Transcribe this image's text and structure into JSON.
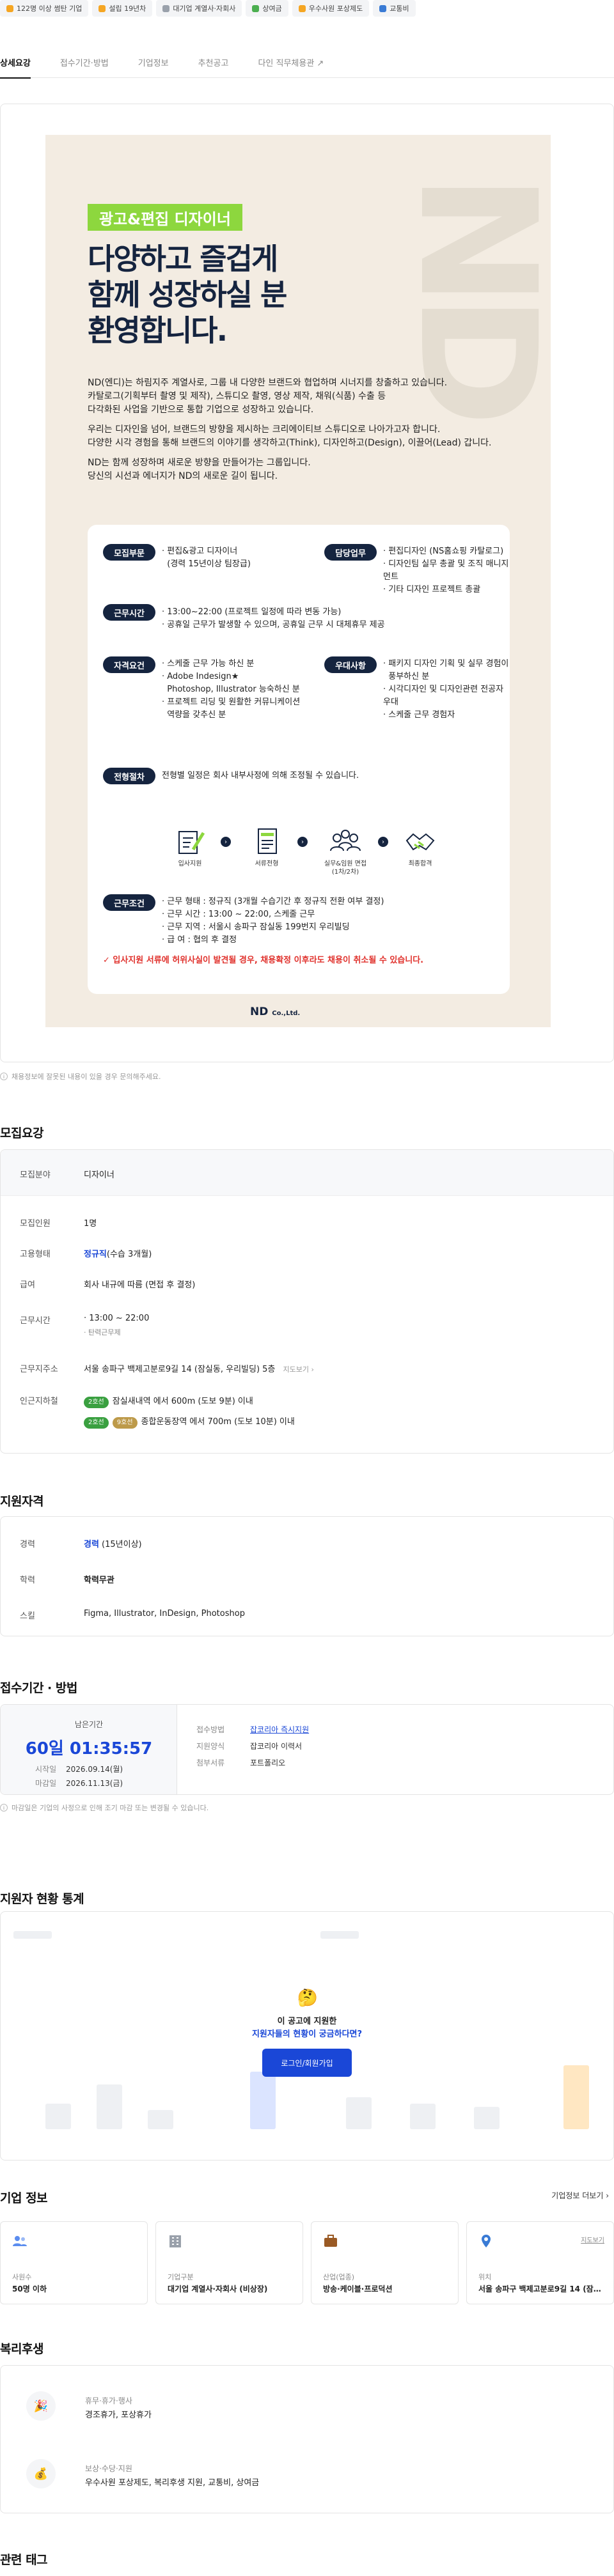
{
  "chips": [
    {
      "label": "122명 이상 썸탄 기업",
      "color": "#f5a623"
    },
    {
      "label": "설립 19년차",
      "color": "#f5a623"
    },
    {
      "label": "대기업 계열사·자회사",
      "color": "#9aa1ab"
    },
    {
      "label": "상여금",
      "color": "#4caf50"
    },
    {
      "label": "우수사원 포상제도",
      "color": "#f5a623"
    },
    {
      "label": "교통비",
      "color": "#3a7bd5"
    }
  ],
  "tabs": [
    {
      "label": "상세요강"
    },
    {
      "label": "접수기간·방법"
    },
    {
      "label": "기업정보"
    },
    {
      "label": "추천공고"
    },
    {
      "label": "다인 직무체용관 ↗"
    }
  ],
  "poster": {
    "watermark": "ND",
    "tag": "광고&편집 디자이너",
    "headline": [
      "다양하고 즐겁게",
      "함께 성장하실 분",
      "환영합니다."
    ],
    "intro": [
      [
        "ND(엔디)는 하림지주 계열사로, 그룹 내 다양한 브랜드와 협업하며 시너지를 창출하고 있습니다.",
        "카탈로그(기획부터 촬영 및 제작), 스튜디오 촬영, 영상 제작, 채워(식품) 수출 등",
        "다각화된 사업을 기반으로 통합 기업으로 성장하고 있습니다."
      ],
      [
        "우리는 디자인을 넘어, 브랜드의 방향을 제시하는 크리에이티브 스튜디오로 나아가고자 합니다.",
        "다양한 시각 경험을 통해 브랜드의 이야기를 생각하고(Think), 디자인하고(Design), 이끌어(Lead) 갑니다."
      ],
      [
        "ND는 함께 성장하며 새로운 방향을 만들어가는 그룹입니다.",
        "당신의 시선과 에너지가 ND의 새로운 길이 됩니다."
      ]
    ],
    "sections": {
      "recruit": {
        "label": "모집부문",
        "lines": [
          "· 편집&광고 디자이너",
          "  (경력 15년이상 팀장급)"
        ]
      },
      "duty": {
        "label": "담당업무",
        "lines": [
          "· 편집디자인 (NS홈쇼핑 카탈로그)",
          "· 디자인팀 실무 총괄 및 조직 매니지먼트",
          "· 기타 디자인 프로젝트 총괄"
        ]
      },
      "hours": {
        "label": "근무시간",
        "lines": [
          "· 13:00~22:00 (프로젝트 일정에 따라 변동 가능)",
          "· 공휴일 근무가 발생할 수 있으며, 공휴일 근무 시 대체휴무 제공"
        ]
      },
      "qual": {
        "label": "자격요건",
        "lines": [
          "· 스케줄 근무 가능 하신 분",
          "· Adobe Indesign★",
          "  Photoshop, Illustrator 능숙하신 분",
          "· 프로젝트 리딩 및 원활한 커뮤니케이션",
          "  역량을 갖추신 분"
        ]
      },
      "pref": {
        "label": "우대사항",
        "lines": [
          "· 패키지 디자인 기획 및 실무 경험이",
          "  풍부하신 분",
          "· 시각디자인 및 디자인관련 전공자 우대",
          "· 스케줄 근무 경험자"
        ]
      },
      "process": {
        "label": "전형절차",
        "text": "전형별 일정은 회사 내부사정에 의해 조정될 수 있습니다."
      },
      "steps": [
        "입사지원",
        "서류전형",
        "실무&임원 면접\n(1차/2차)",
        "최종합격"
      ],
      "cond": {
        "label": "근무조건",
        "lines": [
          "· 근무 형태 : 정규직 (3개월 수습기간 후 정규직 전환 여부 결정)",
          "· 근무 시간 : 13:00 ~ 22:00, 스케줄 근무",
          "· 근무 지역 : 서울시 송파구 잠실동 199번지 우리빌딩",
          "· 급 여 : 협의 후 결정"
        ]
      },
      "warning": "✓ 입사지원 서류에 허위사실이 발견될 경우, 채용확정 이후라도 채용이 취소될 수 있습니다."
    },
    "logo": "ND",
    "logo_suffix": "Co.,Ltd."
  },
  "notice1": "채용정보에 잘못된 내용이 있을 경우 문의해주세요.",
  "summary": {
    "title": "모집요강",
    "field_label": "모집분야",
    "field_value": "디자이너",
    "rows": [
      {
        "k": "모집인원",
        "v": "1명"
      },
      {
        "k": "고용형태",
        "v1": "정규직",
        "v2": "(수습 3개월)"
      },
      {
        "k": "급여",
        "v": "회사 내규에 따름 (면접 후 결정)"
      },
      {
        "k": "근무시간",
        "v": "· 13:00 ~ 22:00",
        "v2": "· 탄력근무제"
      },
      {
        "k": "근무지주소",
        "v": "서울 송파구 백제고분로9길 14 (잠실동, 우리빌딩) 5층",
        "link": "지도보기 ›"
      },
      {
        "k": "인근지하철",
        "s1b": "2호선",
        "s1": "잠실새내역 에서 600m (도보 9분) 이내",
        "s2a": "2호선",
        "s2b": "9호선",
        "s2": "종합운동장역 에서 700m (도보 10분) 이내"
      }
    ]
  },
  "qual": {
    "title": "지원자격",
    "rows": [
      {
        "k": "경력",
        "v1": "경력",
        "v2": " (15년이상)"
      },
      {
        "k": "학력",
        "v1": "학력무관"
      },
      {
        "k": "스킬",
        "v": "Figma, Illustrator, InDesign, Photoshop"
      }
    ]
  },
  "apply": {
    "title": "접수기간 · 방법",
    "remain_label": "남은기간",
    "remain": "60일 01:35:57",
    "start_label": "시작일",
    "start": "2026.09.14(월)",
    "end_label": "마감일",
    "end": "2026.11.13(금)",
    "method_label": "접수방법",
    "method": "잡코리아 즉시지원",
    "form_label": "지원양식",
    "form": "잡코리아 이력서",
    "docs_label": "첨부서류",
    "docs": "포트폴리오",
    "notice": "마감일은 기업의 사정으로 인해 조기 마감 또는 변경될 수 있습니다."
  },
  "stats": {
    "title": "지원자 현황 통계",
    "q1": "이 공고에 지원한",
    "q2": "지원자들의 현황이 궁금하다면?",
    "btn": "로그인/회원가입"
  },
  "company": {
    "title": "기업 정보",
    "more": "기업정보 더보기 ›",
    "cards": [
      {
        "lab": "사원수",
        "val": "50명 이하",
        "color": "#5b8def"
      },
      {
        "lab": "기업구분",
        "val": "대기업 계열사·자회사 (비상장)",
        "color": "#9aa1ab"
      },
      {
        "lab": "산업(업종)",
        "val": "방송·케이블·프로덕션",
        "color": "#9a5a24"
      },
      {
        "lab": "위치",
        "val": "서울 송파구 백제고분로9길 14 (잠실동...",
        "color": "#3a7bd5",
        "link": "지도보기"
      }
    ]
  },
  "benefit": {
    "title": "복리후생",
    "items": [
      {
        "label": "휴무·휴가·행사",
        "value": "경조휴가, 포상휴가",
        "icon": "🎉"
      },
      {
        "label": "보상·수당·지원",
        "value": "우수사원 포상제도, 복리후생 지원, 교통비, 상여금",
        "icon": "💰"
      }
    ]
  },
  "tags": {
    "title": "관련 태그"
  }
}
